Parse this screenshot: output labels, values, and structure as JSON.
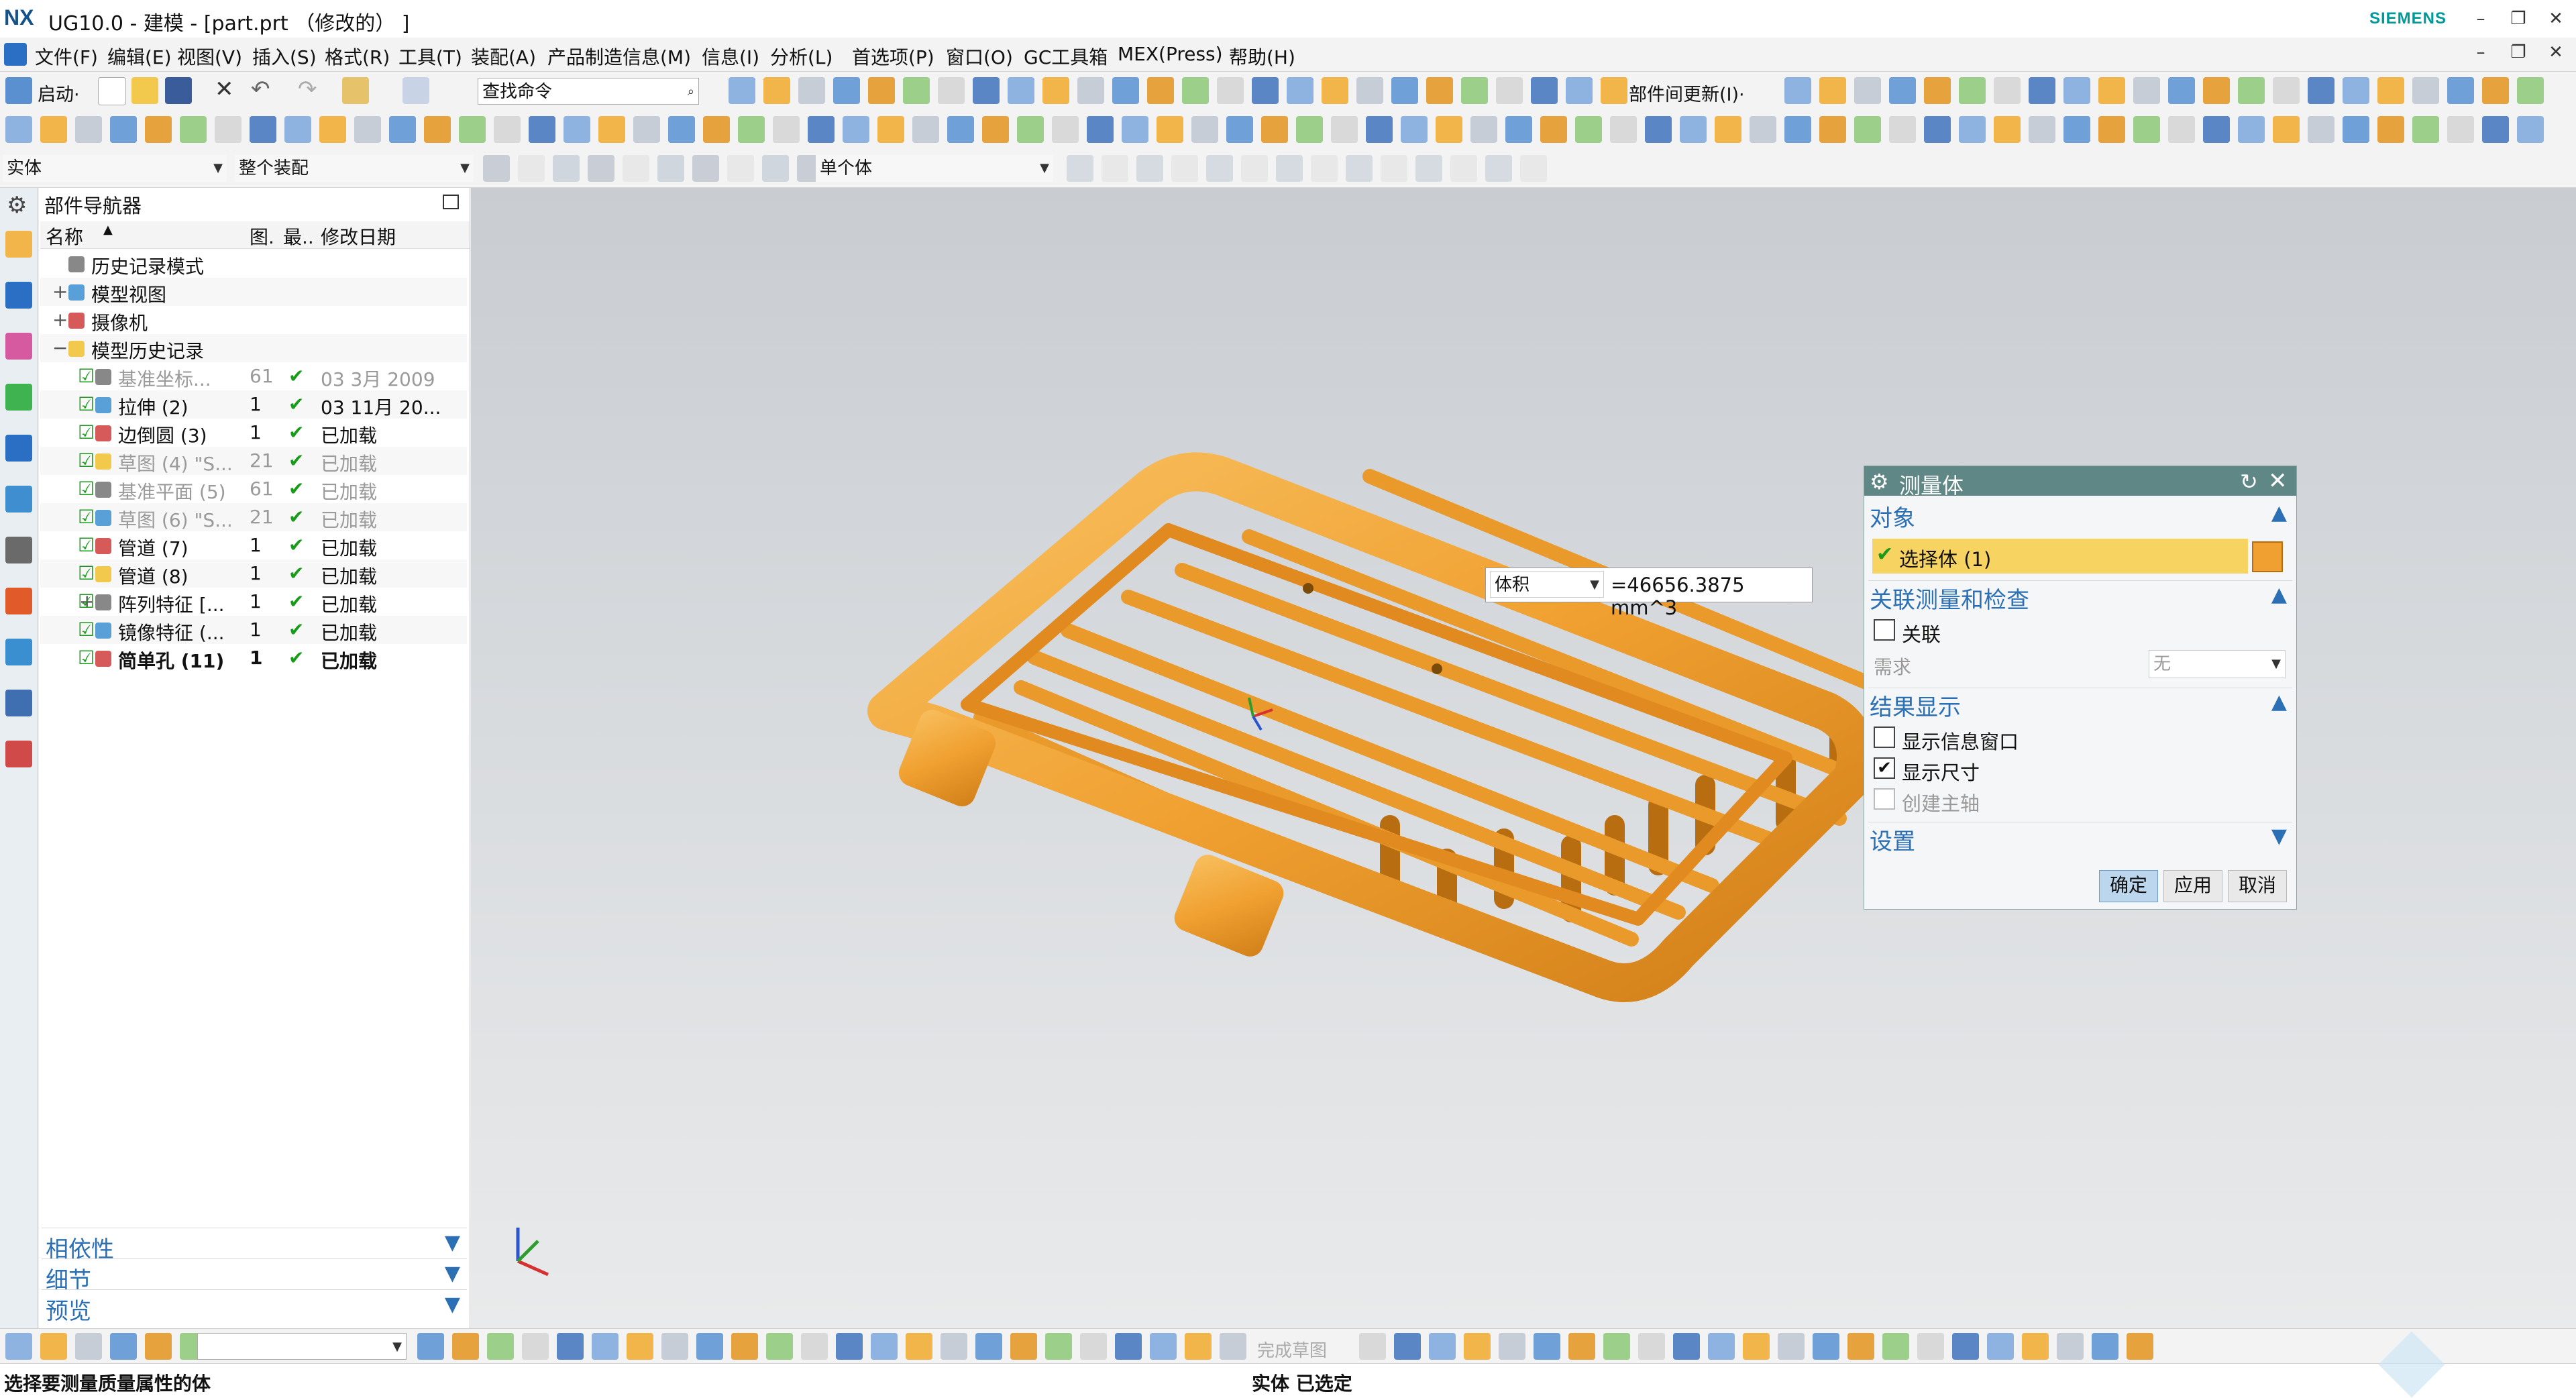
{
  "window": {
    "logo": "NX",
    "title": "UG10.0 - 建模 - [part.prt （修改的） ]",
    "brand": "SIEMENS",
    "controls": [
      "–",
      "❐",
      "✕"
    ],
    "doc_controls": [
      "–",
      "❐",
      "✕"
    ]
  },
  "menu": [
    "文件(F)",
    "编辑(E)",
    "视图(V)",
    "插入(S)",
    "格式(R)",
    "工具(T)",
    "装配(A)",
    "产品制造信息(M)",
    "信息(I)",
    "分析(L)",
    "首选项(P)",
    "窗口(O)",
    "GC工具箱",
    "MEX(Press)",
    "帮助(H)"
  ],
  "toolbar": {
    "start_label": "启动·",
    "search_placeholder": "查找命令",
    "interpart_update": "部件间更新(I)·",
    "filter_type": "实体",
    "assembly_scope": "整个装配",
    "body_filter": "单个体"
  },
  "navigator": {
    "title": "部件导航器",
    "columns": [
      "名称",
      "图.",
      "最..",
      "修改日期"
    ],
    "rows": [
      {
        "name": "历史记录模式",
        "fig": "",
        "latest": "",
        "date": "",
        "style": "normal"
      },
      {
        "name": "模型视图",
        "fig": "",
        "latest": "",
        "date": "",
        "style": "normal"
      },
      {
        "name": "摄像机",
        "fig": "",
        "latest": "",
        "date": "",
        "style": "normal"
      },
      {
        "name": "模型历史记录",
        "fig": "",
        "latest": "",
        "date": "",
        "style": "normal"
      },
      {
        "name": "基准坐标...",
        "fig": "61",
        "latest": "✔",
        "date": "03 3月 2009",
        "style": "gray"
      },
      {
        "name": "拉伸 (2)",
        "fig": "1",
        "latest": "✔",
        "date": "03 11月 20...",
        "style": "normal"
      },
      {
        "name": "边倒圆 (3)",
        "fig": "1",
        "latest": "✔",
        "date": "已加载",
        "style": "normal"
      },
      {
        "name": "草图 (4) \"S...",
        "fig": "21",
        "latest": "✔",
        "date": "已加载",
        "style": "gray"
      },
      {
        "name": "基准平面 (5)",
        "fig": "61",
        "latest": "✔",
        "date": "已加载",
        "style": "gray"
      },
      {
        "name": "草图 (6) \"S...",
        "fig": "21",
        "latest": "✔",
        "date": "已加载",
        "style": "gray"
      },
      {
        "name": "管道 (7)",
        "fig": "1",
        "latest": "✔",
        "date": "已加载",
        "style": "normal"
      },
      {
        "name": "管道 (8)",
        "fig": "1",
        "latest": "✔",
        "date": "已加载",
        "style": "normal"
      },
      {
        "name": "阵列特征 [...",
        "fig": "1",
        "latest": "✔",
        "date": "已加载",
        "style": "normal"
      },
      {
        "name": "镜像特征 (...",
        "fig": "1",
        "latest": "✔",
        "date": "已加载",
        "style": "normal"
      },
      {
        "name": "简单孔 (11)",
        "fig": "1",
        "latest": "✔",
        "date": "已加载",
        "style": "bold"
      }
    ],
    "panels": [
      "相依性",
      "细节",
      "预览"
    ]
  },
  "measure_label": {
    "type": "体积",
    "value": "=46656.3875 mm^3"
  },
  "dialog": {
    "title": "测量体",
    "section_object": "对象",
    "select_body": "选择体 (1)",
    "section_assoc": "关联测量和检查",
    "assoc_label": "关联",
    "demand_label": "需求",
    "demand_value": "无",
    "section_result": "结果显示",
    "show_info_window": "显示信息窗口",
    "show_size": "显示尺寸",
    "create_axis": "创建主轴",
    "section_settings": "设置",
    "ok": "确定",
    "apply": "应用",
    "cancel": "取消"
  },
  "bottom_toolbar": {
    "finish_sketch": "完成草图"
  },
  "status": {
    "prompt": "选择要测量质量属性的体",
    "selection": "实体 已选定"
  },
  "colors": {
    "model_orange": "#f0a030",
    "dialog_header": "#5f8785",
    "accent_blue": "#2b6fb5",
    "highlight_yellow": "#f7d361"
  }
}
